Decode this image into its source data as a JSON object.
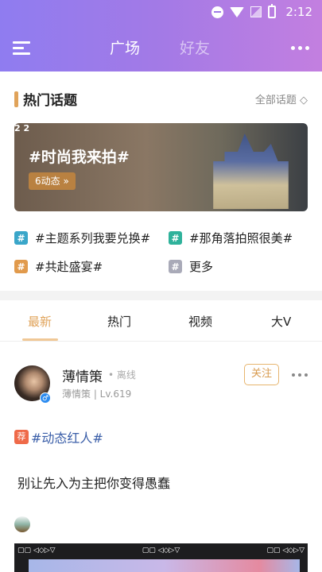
{
  "status_bar": {
    "time": "2:12"
  },
  "header": {
    "tabs": [
      {
        "label": "广场",
        "active": true
      },
      {
        "label": "好友",
        "active": false
      }
    ]
  },
  "topics": {
    "title": "热门话题",
    "all_label": "全部话题",
    "banner": {
      "corner_text": "2 2",
      "title": "#时尚我来拍#",
      "badge": "6动态"
    },
    "items": [
      {
        "label": "#主题系列我要兑换#",
        "color": "#3aa6c9"
      },
      {
        "label": "#那角落拍照很美#",
        "color": "#2fb29b"
      },
      {
        "label": "#共赴盛宴#",
        "color": "#e19a4c"
      },
      {
        "label": "更多",
        "color": "#a9aab8"
      }
    ]
  },
  "feed_tabs": [
    {
      "label": "最新",
      "active": true
    },
    {
      "label": "热门",
      "active": false
    },
    {
      "label": "视频",
      "active": false
    },
    {
      "label": "大V",
      "active": false
    }
  ],
  "post": {
    "username": "薄情策",
    "status": "• 离线",
    "user_meta": "薄情策 | Lv.619",
    "follow_label": "关注",
    "tag_badge": "荐",
    "tag": "#动态红人#",
    "text": "别让先入为主把你变得愚蠢"
  },
  "colors": {
    "accent": "#e0a35a",
    "header_start": "#8f7cf0",
    "header_end": "#c37fe0",
    "tag_link": "#3a5ea8"
  }
}
